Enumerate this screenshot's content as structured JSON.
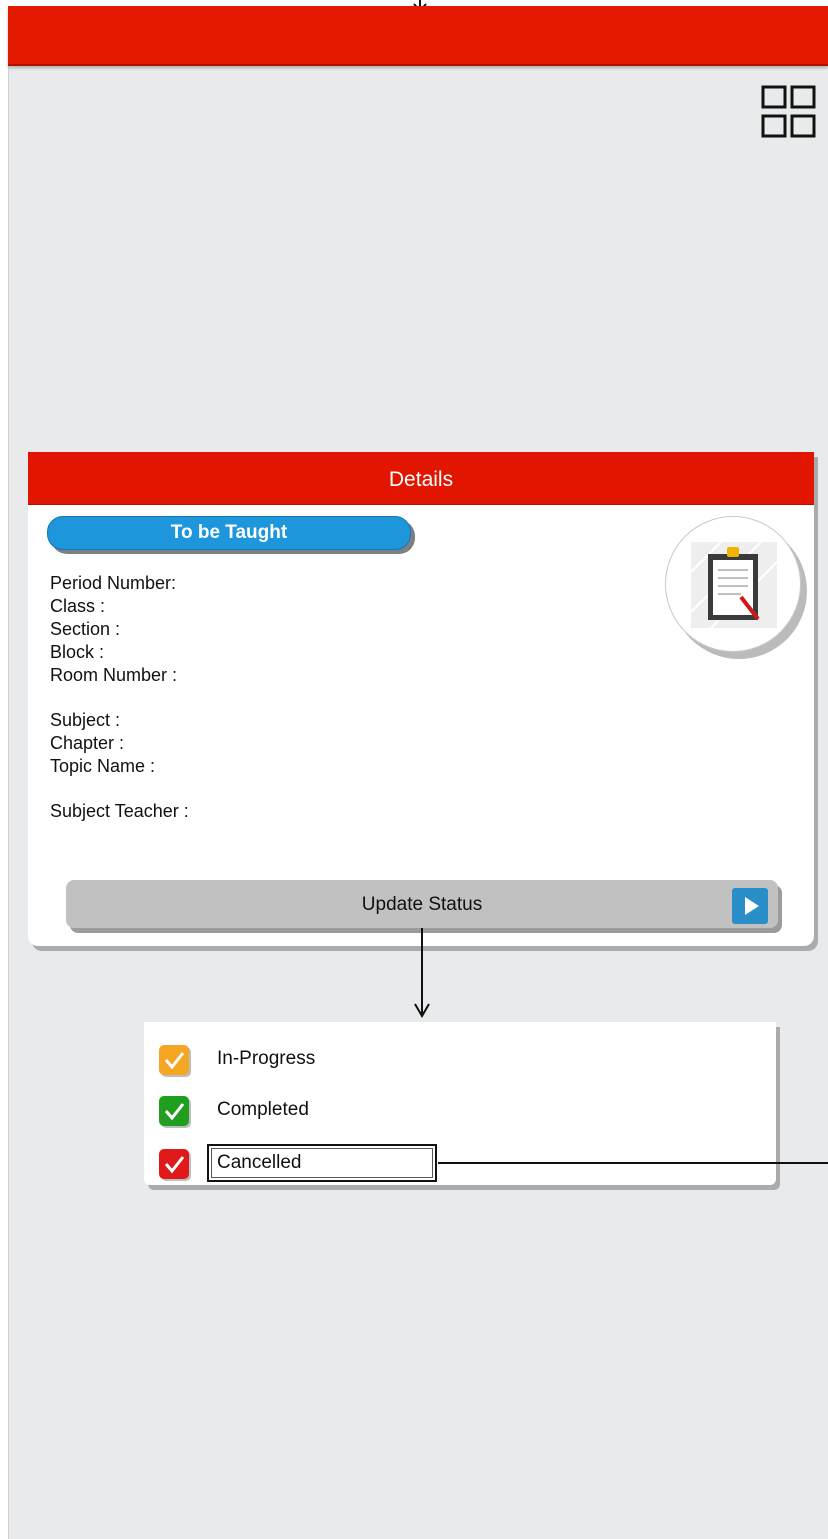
{
  "details": {
    "title": "Details",
    "status_pill": "To be Taught",
    "fields": [
      "Period Number:",
      "Class :",
      "Section :",
      "Block :",
      "Room Number :",
      "Subject :",
      "Chapter :",
      "Topic Name :",
      "Subject Teacher :"
    ],
    "update_button": "Update Status"
  },
  "status_options": [
    {
      "label": "In-Progress",
      "color": "#f5a623"
    },
    {
      "label": "Completed",
      "color": "#1f9e1f"
    },
    {
      "label": "Cancelled",
      "color": "#e01a1a"
    }
  ],
  "selected_status": "Cancelled",
  "icons": {
    "grid": "grid-view-icon",
    "avatar": "clipboard-icon",
    "update": "play-icon"
  },
  "colors": {
    "header": "#e41a00",
    "pill": "#1e96dc",
    "button": "#c1c1c1"
  }
}
